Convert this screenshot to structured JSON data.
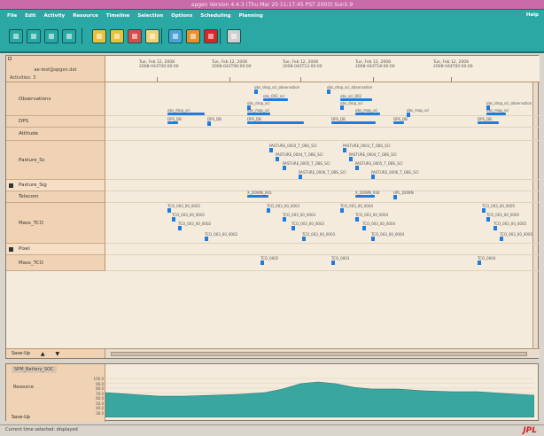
{
  "window": {
    "title": "apgen Version 4.4.3 (Thu Mar 20 11:17:45 PST 2003) Sun5.9"
  },
  "menu": {
    "items": [
      "File",
      "Edit",
      "Activity",
      "Resource",
      "Timeline",
      "Selection",
      "Options",
      "Scheduling",
      "Planning"
    ],
    "help": "Help"
  },
  "toolbar": {
    "buttons": [
      {
        "icon": "pointer-icon",
        "color": "#2aa9a4"
      },
      {
        "icon": "edit-icon",
        "color": "#2aa9a4"
      },
      {
        "icon": "check-icon",
        "color": "#2aa9a4"
      },
      {
        "icon": "grid-icon",
        "color": "#2aa9a4"
      },
      {
        "icon": "open-folder-icon",
        "color": "#e8c23a"
      },
      {
        "icon": "new-plan-icon",
        "color": "#e8c23a"
      },
      {
        "icon": "save-plan-icon",
        "color": "#d94b4b"
      },
      {
        "icon": "document-icon",
        "color": "#f2d276"
      },
      {
        "icon": "layers-icon",
        "color": "#4aa3d6"
      },
      {
        "icon": "schedule-icon",
        "color": "#e9902b"
      },
      {
        "icon": "delete-icon",
        "color": "#d92626"
      },
      {
        "icon": "print-icon",
        "color": "#d0cfcf"
      }
    ]
  },
  "timeline": {
    "header_title": "ae-test@apgen.dat",
    "header_sub": "Activities: 3",
    "ticks": [
      {
        "d": "Tue, Feb 12, 2008",
        "s": "2008-043T00:00:00"
      },
      {
        "d": "Tue, Feb 12, 2008",
        "s": "2008-043T06:00:00"
      },
      {
        "d": "Tue, Feb 12, 2008",
        "s": "2008-043T12:00:00"
      },
      {
        "d": "Tue, Feb 12, 2008",
        "s": "2008-043T18:00:00"
      },
      {
        "d": "Tue, Feb 12, 2008",
        "s": "2008-044T00:00:00"
      }
    ],
    "rows": [
      {
        "label": "Observations",
        "strip": false,
        "checked": false
      },
      {
        "label": "DPS",
        "strip": false,
        "checked": false
      },
      {
        "label": "Attitude",
        "strip": false,
        "checked": false
      },
      {
        "label": "Pasture_Sc",
        "strip": false,
        "checked": false
      },
      {
        "label": "Pasture_Sig",
        "strip": true,
        "checked": true
      },
      {
        "label": "Telecom",
        "strip": false,
        "checked": false
      },
      {
        "label": "Mass_TCO",
        "strip": false,
        "checked": false
      },
      {
        "label": "Pixel",
        "strip": true,
        "checked": true
      },
      {
        "label": "Mass_TCO",
        "strip": false,
        "checked": false
      }
    ],
    "activity_labels": {
      "obs": [
        "obs_drop_sci_observation",
        "obs_drop_sci_observation",
        "obs_002_sci",
        "obs_sci_002",
        "obs_drop_sci",
        "obs_drop_sci",
        "obs_drop_sci_observation",
        "obs_drop_sci",
        "obs_map_sci",
        "obs_map_sci",
        "obs_map_sci",
        "obs_map_sci"
      ],
      "dps": [
        "DPS_DB",
        "DPS_DB",
        "DPS_DB",
        "DPS_DB",
        "DPS_DB",
        "DPS_DB"
      ],
      "pasture": [
        "PASTURE_0003_T_OBS_SCI",
        "PASTURE_0003_T_OBS_SCI",
        "PASTURE_0004_T_OBS_SCI",
        "PASTURE_0004_T_OBS_SCI",
        "PASTURE_0005_T_OBS_SCI",
        "PASTURE_0005_T_OBS_SCI",
        "PASTURE_0006_T_OBS_SCI",
        "PASTURE_0006_T_OBS_SCI"
      ],
      "telecom": [
        "X_DOWN_003",
        "X_DOWN_004",
        "UPL_DOWN"
      ],
      "mass": [
        "TCO_003_00_0002",
        "TCO_003_00_0002",
        "TCO_003_00_0002",
        "TCO_003_00_0002",
        "TCO_003_00_0003",
        "TCO_003_00_0003",
        "TCO_003_00_0003",
        "TCO_003_00_0003",
        "TCO_003_00_0004",
        "TCO_003_00_0004",
        "TCO_003_00_0004",
        "TCO_003_00_0004",
        "TCO_003_00_0005",
        "TCO_003_00_0005",
        "TCO_003_00_0005",
        "TCO_003_00_0005"
      ],
      "pixel": [
        "TCO_0002",
        "TCO_0003",
        "TCO_0004"
      ]
    },
    "nav_label": "Save-Up"
  },
  "resource_plot": {
    "tab": "SPM_Battery_SOC",
    "name": "Resource",
    "y_ticks": [
      "100.0",
      "90.0",
      "80.0",
      "70.0",
      "60.0",
      "50.0",
      "40.0",
      "30.0"
    ],
    "nav_label": "Save-Up",
    "color": "#3aa6a0"
  },
  "status": {
    "text": "Current time selected: displayed",
    "logo": "JPL"
  }
}
